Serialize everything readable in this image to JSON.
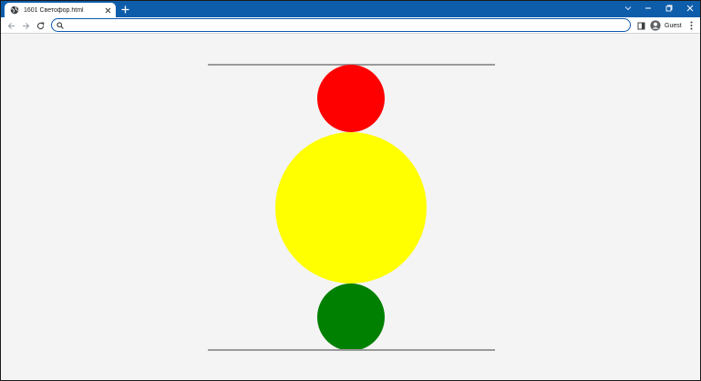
{
  "tab": {
    "title": "1601 Светофор.html"
  },
  "toolbar": {
    "address_value": "",
    "profile_label": "Guest"
  },
  "page": {
    "lights": [
      {
        "name": "red",
        "color": "#ff0000"
      },
      {
        "name": "yellow",
        "color": "#ffff00"
      },
      {
        "name": "green",
        "color": "#008000"
      }
    ]
  },
  "colors": {
    "tabstrip": "#0e5dab",
    "omnibox_border": "#0b57b0",
    "page_background": "#f4f4f4"
  }
}
